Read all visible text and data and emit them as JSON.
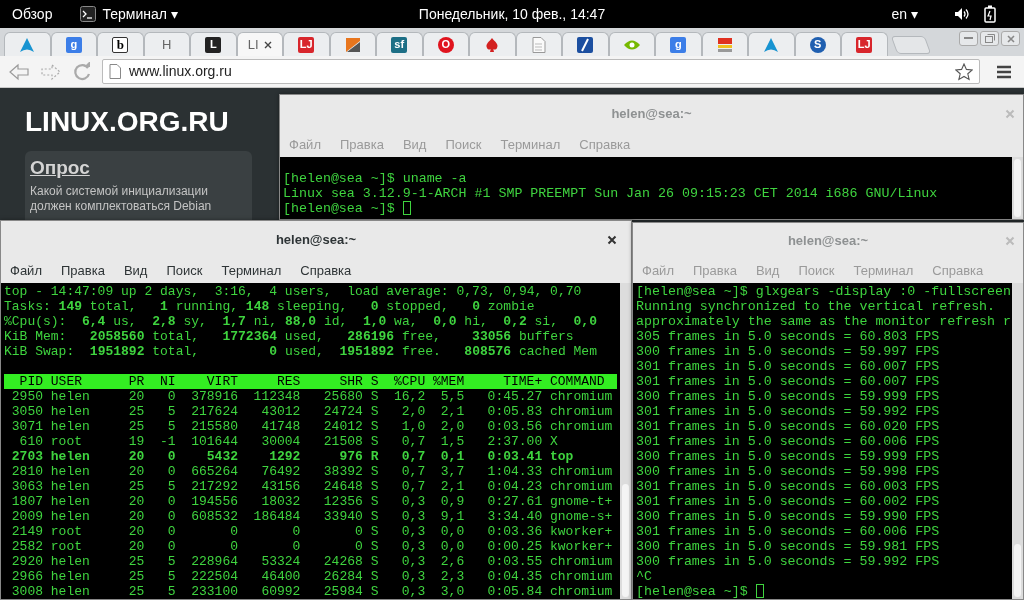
{
  "top_bar": {
    "activities": "Обзор",
    "app_menu": "Терминал ▾",
    "clock": "Понедельник, 10 фев., 14:47",
    "keyboard_layout": "en ▾"
  },
  "browser": {
    "tabs": [
      {
        "kind": "arch",
        "color": "#1793d1",
        "selected": false
      },
      {
        "kind": "letter",
        "text": "g",
        "color": "#3c7ee8",
        "selected": false
      },
      {
        "kind": "letter-light",
        "text": "b",
        "selected": false
      },
      {
        "kind": "title",
        "title": "H",
        "selected": false
      },
      {
        "kind": "letter",
        "text": "L",
        "color": "#222222",
        "selected": false
      },
      {
        "kind": "title",
        "title": "LI",
        "selected": true
      },
      {
        "kind": "letter",
        "text": "LJ",
        "color": "#d8262c",
        "selected": false
      },
      {
        "kind": "diag",
        "color": "#e8761e",
        "selected": false
      },
      {
        "kind": "letter",
        "text": "sf",
        "color": "#1d6f86",
        "selected": false
      },
      {
        "kind": "letter-round",
        "text": "O",
        "color": "#e0141e",
        "selected": false
      },
      {
        "kind": "spade",
        "color": "#d32020",
        "selected": false
      },
      {
        "kind": "doc",
        "selected": false
      },
      {
        "kind": "slash",
        "color": "#1c4fa0",
        "selected": false
      },
      {
        "kind": "eye",
        "color": "#76b900",
        "selected": false
      },
      {
        "kind": "letter",
        "text": "g",
        "color": "#3c7ee8",
        "selected": false
      },
      {
        "kind": "stripes",
        "color": "#e03020",
        "selected": false
      },
      {
        "kind": "arch",
        "color": "#1793d1",
        "selected": false
      },
      {
        "kind": "letter-round",
        "text": "S",
        "color": "#1f5fb0",
        "selected": false
      },
      {
        "kind": "letter",
        "text": "LJ",
        "color": "#d8262c",
        "selected": false
      }
    ],
    "url": "www.linux.org.ru"
  },
  "page": {
    "logo": "LINUX.ORG.RU",
    "poll": {
      "title": "Опрос",
      "lines": [
        "Какой системой инициализации",
        "должен комплектоваться Debian"
      ]
    }
  },
  "windows": [
    {
      "kind": "terminal",
      "title": "helen@sea:~",
      "focused": false,
      "menu": [
        "Файл",
        "Правка",
        "Вид",
        "Поиск",
        "Терминал",
        "Справка"
      ],
      "lines": [
        "[helen@sea ~]$ uname -a",
        "Linux sea 3.12.9-1-ARCH #1 SMP PREEMPT Sun Jan 26 09:15:23 CET 2014 i686 GNU/Linux",
        "[helen@sea ~]$"
      ],
      "cursor": true
    },
    {
      "kind": "terminal",
      "title": "helen@sea:~",
      "focused": true,
      "menu": [
        "Файл",
        "Правка",
        "Вид",
        "Поиск",
        "Терминал",
        "Справка"
      ],
      "lines": [
        "top - 14:47:09 up 2 days,  3:16,  4 users,  load average: 0,73, 0,94, 0,70",
        "Tasks: **149** total,   **1** running, **148** sleeping,   **0** stopped,   **0** zombie",
        "%Cpu(s):  **6,4** us,  **2,8** sy,  **1,7** ni, **88,0** id,  **1,0** wa,  **0,0** hi,  **0,2** si,  **0,0**",
        "KiB Mem:   **2058560** total,   **1772364** used,   **286196** free,    **33056** buffers",
        "KiB Swap:  **1951892** total,         **0** used,  **1951892** free.   **808576** cached Mem"
      ],
      "table": {
        "columns": [
          "PID",
          "USER",
          "PR",
          "NI",
          "VIRT",
          "RES",
          "SHR",
          "S",
          "%CPU",
          "%MEM",
          "TIME+",
          "COMMAND"
        ],
        "rows": [
          {
            "cells": [
              "2950",
              "helen",
              "20",
              "0",
              "378916",
              "112348",
              "25680",
              "S",
              "16,2",
              "5,5",
              "0:45.27",
              "chromium"
            ],
            "highlighted": false
          },
          {
            "cells": [
              "3050",
              "helen",
              "25",
              "5",
              "217624",
              "43012",
              "24724",
              "S",
              "2,0",
              "2,1",
              "0:05.83",
              "chromium"
            ],
            "highlighted": false
          },
          {
            "cells": [
              "3071",
              "helen",
              "25",
              "5",
              "215580",
              "41748",
              "24012",
              "S",
              "1,0",
              "2,0",
              "0:03.56",
              "chromium"
            ],
            "highlighted": false
          },
          {
            "cells": [
              "610",
              "root",
              "19",
              "-1",
              "101644",
              "30004",
              "21508",
              "S",
              "0,7",
              "1,5",
              "2:37.00",
              "X"
            ],
            "highlighted": false
          },
          {
            "cells": [
              "2703",
              "helen",
              "20",
              "0",
              "5432",
              "1292",
              "976",
              "R",
              "0,7",
              "0,1",
              "0:03.41",
              "top"
            ],
            "highlighted": true
          },
          {
            "cells": [
              "2810",
              "helen",
              "20",
              "0",
              "665264",
              "76492",
              "38392",
              "S",
              "0,7",
              "3,7",
              "1:04.33",
              "chromium"
            ],
            "highlighted": false
          },
          {
            "cells": [
              "3063",
              "helen",
              "25",
              "5",
              "217292",
              "43156",
              "24648",
              "S",
              "0,7",
              "2,1",
              "0:04.23",
              "chromium"
            ],
            "highlighted": false
          },
          {
            "cells": [
              "1807",
              "helen",
              "20",
              "0",
              "194556",
              "18032",
              "12356",
              "S",
              "0,3",
              "0,9",
              "0:27.61",
              "gnome-t+"
            ],
            "highlighted": false
          },
          {
            "cells": [
              "2009",
              "helen",
              "20",
              "0",
              "608532",
              "186484",
              "33940",
              "S",
              "0,3",
              "9,1",
              "3:34.40",
              "gnome-s+"
            ],
            "highlighted": false
          },
          {
            "cells": [
              "2149",
              "root",
              "20",
              "0",
              "0",
              "0",
              "0",
              "S",
              "0,3",
              "0,0",
              "0:03.36",
              "kworker+"
            ],
            "highlighted": false
          },
          {
            "cells": [
              "2582",
              "root",
              "20",
              "0",
              "0",
              "0",
              "0",
              "S",
              "0,3",
              "0,0",
              "0:00.25",
              "kworker+"
            ],
            "highlighted": false
          },
          {
            "cells": [
              "2920",
              "helen",
              "25",
              "5",
              "228964",
              "53324",
              "24268",
              "S",
              "0,3",
              "2,6",
              "0:03.55",
              "chromium"
            ],
            "highlighted": false
          },
          {
            "cells": [
              "2966",
              "helen",
              "25",
              "5",
              "222504",
              "46400",
              "26284",
              "S",
              "0,3",
              "2,3",
              "0:04.35",
              "chromium"
            ],
            "highlighted": false
          },
          {
            "cells": [
              "3008",
              "helen",
              "25",
              "5",
              "233100",
              "60992",
              "25984",
              "S",
              "0,3",
              "3,0",
              "0:05.84",
              "chromium"
            ],
            "highlighted": false
          }
        ]
      }
    },
    {
      "kind": "terminal",
      "title": "helen@sea:~",
      "focused": false,
      "menu": [
        "Файл",
        "Правка",
        "Вид",
        "Поиск",
        "Терминал",
        "Справка"
      ],
      "lines": [
        "[helen@sea ~]$ glxgears -display :0 -fullscreen",
        "Running synchronized to the vertical refresh.",
        "approximately the same as the monitor refresh r",
        "305 frames in 5.0 seconds = 60.803 FPS",
        "300 frames in 5.0 seconds = 59.997 FPS",
        "301 frames in 5.0 seconds = 60.007 FPS",
        "301 frames in 5.0 seconds = 60.007 FPS",
        "300 frames in 5.0 seconds = 59.999 FPS",
        "301 frames in 5.0 seconds = 59.992 FPS",
        "301 frames in 5.0 seconds = 60.020 FPS",
        "301 frames in 5.0 seconds = 60.006 FPS",
        "300 frames in 5.0 seconds = 59.999 FPS",
        "300 frames in 5.0 seconds = 59.998 FPS",
        "301 frames in 5.0 seconds = 60.003 FPS",
        "301 frames in 5.0 seconds = 60.002 FPS",
        "300 frames in 5.0 seconds = 59.990 FPS",
        "301 frames in 5.0 seconds = 60.006 FPS",
        "300 frames in 5.0 seconds = 59.981 FPS",
        "300 frames in 5.0 seconds = 59.992 FPS",
        "^C",
        "[helen@sea ~]$"
      ],
      "cursor": true
    }
  ]
}
